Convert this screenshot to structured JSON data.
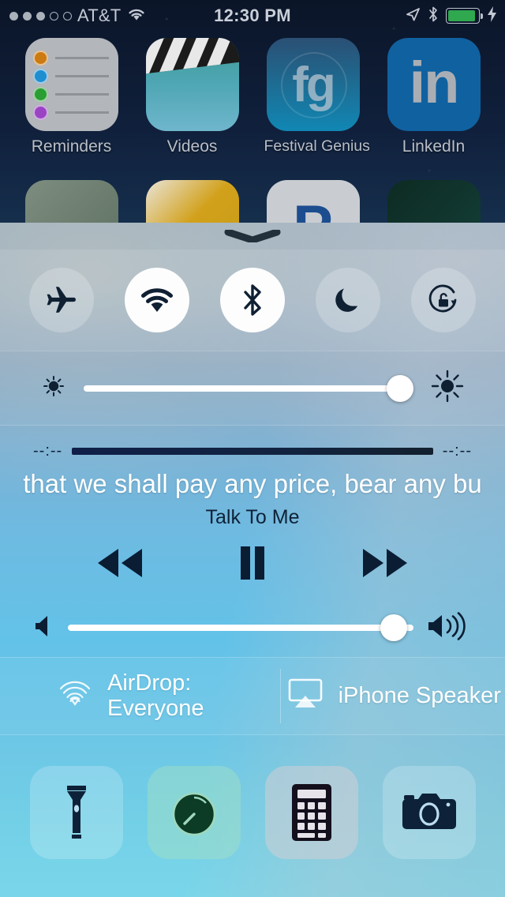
{
  "status_bar": {
    "signal_dots_filled": 3,
    "signal_dots_total": 5,
    "carrier": "AT&T",
    "wifi_icon": "wifi-icon",
    "time": "12:30 PM",
    "location_icon": "location-arrow-icon",
    "bluetooth_icon": "bluetooth-icon",
    "battery_icon": "battery-icon",
    "battery_level_percent": 92,
    "battery_color": "#2fa84f",
    "charging_icon": "lightning-bolt-icon"
  },
  "home_screen": {
    "row1": [
      {
        "name": "Reminders",
        "icon": "reminders-app-icon"
      },
      {
        "name": "Videos",
        "icon": "videos-app-icon"
      },
      {
        "name": "Festival Genius",
        "icon": "festival-genius-app-icon",
        "glyph": "fg"
      },
      {
        "name": "LinkedIn",
        "icon": "linkedin-app-icon",
        "glyph": "in"
      }
    ],
    "row2": [
      {
        "name": "",
        "icon": "app-icon-partial-1"
      },
      {
        "name": "",
        "icon": "app-icon-partial-2"
      },
      {
        "name": "",
        "icon": "app-icon-partial-3",
        "glyph": "P"
      },
      {
        "name": "",
        "icon": "app-icon-partial-4"
      }
    ]
  },
  "control_center": {
    "grabber_icon": "grabber-chevron-icon",
    "toggles": [
      {
        "name": "Airplane Mode",
        "icon": "airplane-icon",
        "state": "off"
      },
      {
        "name": "Wi-Fi",
        "icon": "wifi-icon",
        "state": "on"
      },
      {
        "name": "Bluetooth",
        "icon": "bluetooth-icon",
        "state": "on"
      },
      {
        "name": "Do Not Disturb",
        "icon": "moon-icon",
        "state": "off"
      },
      {
        "name": "Rotation Lock",
        "icon": "rotation-lock-icon",
        "state": "off"
      }
    ],
    "brightness": {
      "low_icon": "brightness-low-icon",
      "high_icon": "brightness-high-icon",
      "value_percent": 100
    },
    "media": {
      "elapsed_time": "--:--",
      "remaining_time": "--:--",
      "progress_percent": 100,
      "track_title": "that we shall pay any price, bear any bu",
      "track_subtitle": "Talk To Me",
      "rewind_icon": "rewind-icon",
      "playpause_icon": "pause-icon",
      "forward_icon": "fast-forward-icon",
      "playback_state": "playing"
    },
    "volume": {
      "low_icon": "volume-low-icon",
      "high_icon": "volume-high-icon",
      "value_percent": 96
    },
    "share": {
      "airdrop_icon": "airdrop-icon",
      "airdrop_label_line1": "AirDrop:",
      "airdrop_label_line2": "Everyone",
      "airplay_icon": "airplay-icon",
      "airplay_label": "iPhone Speaker"
    },
    "shortcuts": [
      {
        "name": "Flashlight",
        "icon": "flashlight-icon"
      },
      {
        "name": "Timer",
        "icon": "timer-icon"
      },
      {
        "name": "Calculator",
        "icon": "calculator-icon"
      },
      {
        "name": "Camera",
        "icon": "camera-icon"
      }
    ]
  }
}
